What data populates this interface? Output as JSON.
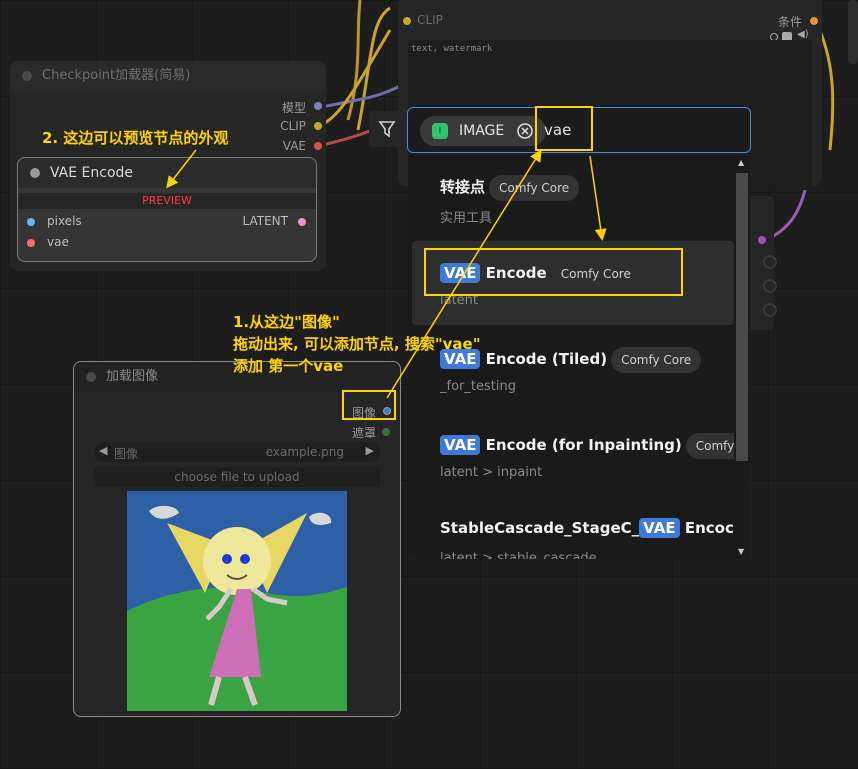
{
  "colors": {
    "annotation": "#ffd400",
    "search_border": "#4a8bd2",
    "highlight": "#3f7bd6",
    "image_type": "#2ec46c",
    "preview_text": "#ff3b3b"
  },
  "clip_node": {
    "input_label": "CLIP",
    "output_label": "条件",
    "text_value": "text, watermark"
  },
  "checkpoint_node": {
    "title": "Checkpoint加载器(简易)",
    "outputs": [
      "模型",
      "CLIP",
      "VAE"
    ]
  },
  "vae_encode_preview": {
    "title": "VAE Encode",
    "preview_label": "PREVIEW",
    "inputs": [
      "pixels",
      "vae"
    ],
    "output": "LATENT"
  },
  "load_image_node": {
    "title": "加载图像",
    "outputs": [
      "图像",
      "遮罩"
    ],
    "image_widget_label": "图像",
    "image_widget_value": "example.png",
    "upload_button": "choose file to upload"
  },
  "search": {
    "filter_icon": "filter-icon",
    "type_chip": "IMAGE",
    "type_chip_badge": "I",
    "query": "vae"
  },
  "results": [
    {
      "title_pre": "转接点",
      "hl": "",
      "title_post": "",
      "badge": "Comfy Core",
      "category": "实用工具"
    },
    {
      "title_pre": "",
      "hl": "VAE",
      "title_post": " Encode",
      "badge": "Comfy Core",
      "category": "latent"
    },
    {
      "title_pre": "",
      "hl": "VAE",
      "title_post": " Encode (Tiled)",
      "badge": "Comfy Core",
      "category": "_for_testing"
    },
    {
      "title_pre": "",
      "hl": "VAE",
      "title_post": " Encode (for Inpainting)",
      "badge": "Comfy C",
      "category": "latent > inpaint"
    },
    {
      "title_pre": "StableCascade_StageC_",
      "hl": "VAE",
      "title_post": " Encoc",
      "badge": "",
      "category": "latent > stable_cascade"
    }
  ],
  "annotations": {
    "note_preview": "2. 这边可以预览节点的外观",
    "note_drag_1": "1.从这边\"图像\"",
    "note_drag_2": "拖动出来, 可以添加节点, 搜索\"vae\"",
    "note_drag_3": "添加 第一个vae"
  }
}
